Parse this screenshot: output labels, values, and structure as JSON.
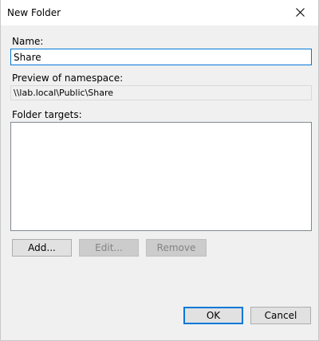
{
  "window": {
    "title": "New Folder"
  },
  "form": {
    "name_label": "Name:",
    "name_value": "Share",
    "preview_label": "Preview of namespace:",
    "preview_value": "\\\\lab.local\\Public\\Share",
    "targets_label": "Folder targets:",
    "targets": []
  },
  "target_buttons": {
    "add": "Add...",
    "edit": "Edit...",
    "remove": "Remove"
  },
  "dialog_buttons": {
    "ok": "OK",
    "cancel": "Cancel"
  },
  "icons": {
    "close": "close-icon"
  },
  "colors": {
    "accent": "#0078d7",
    "dialog_background": "#f0f0f0",
    "titlebar_background": "#ffffff"
  }
}
